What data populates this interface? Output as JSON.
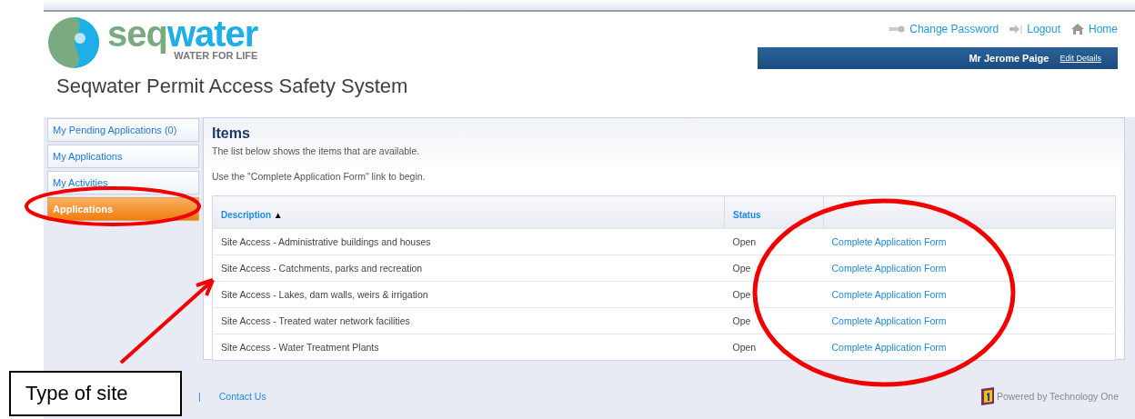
{
  "logo": {
    "part_a": "seq",
    "part_b": "water",
    "tagline": "WATER FOR LIFE"
  },
  "site_title": "Seqwater Permit Access Safety System",
  "top_links": [
    {
      "label": "Change Password",
      "kind": "key"
    },
    {
      "label": "Logout",
      "kind": "logout"
    },
    {
      "label": "Home",
      "kind": "home"
    }
  ],
  "user_bar": {
    "name": "Mr Jerome Paige",
    "link": "Edit Details"
  },
  "sidebar": {
    "items": [
      {
        "label": "My Pending Applications (0)",
        "selected": false
      },
      {
        "label": "My Applications",
        "selected": false
      },
      {
        "label": "My Activities",
        "selected": false
      },
      {
        "label": "Applications",
        "selected": true
      }
    ]
  },
  "panel": {
    "title": "Items",
    "intro": "The list below shows the items that are available.",
    "hint": "Use the \"Complete Application Form\" link to begin."
  },
  "table": {
    "columns": [
      {
        "label": "Description",
        "sort": "▲"
      },
      {
        "label": "Status"
      }
    ],
    "rows": [
      {
        "description": "Site Access - Administrative buildings and houses",
        "status": "Open",
        "action": "Complete Application Form"
      },
      {
        "description": "Site Access - Catchments, parks and recreation",
        "status": "Ope",
        "action": "Complete Application Form"
      },
      {
        "description": "Site Access - Lakes, dam walls, weirs & irrigation",
        "status": "Ope",
        "action": "Complete Application Form"
      },
      {
        "description": "Site Access - Treated water network facilities",
        "status": "Ope",
        "action": "Complete Application Form"
      },
      {
        "description": "Site Access - Water Treatment Plants",
        "status": "Open",
        "action": "Complete Application Form"
      }
    ]
  },
  "footer": {
    "separator": "|",
    "link": "Contact Us",
    "powered": "Powered by Technology One"
  },
  "annotation": {
    "callout": "Type of site"
  }
}
